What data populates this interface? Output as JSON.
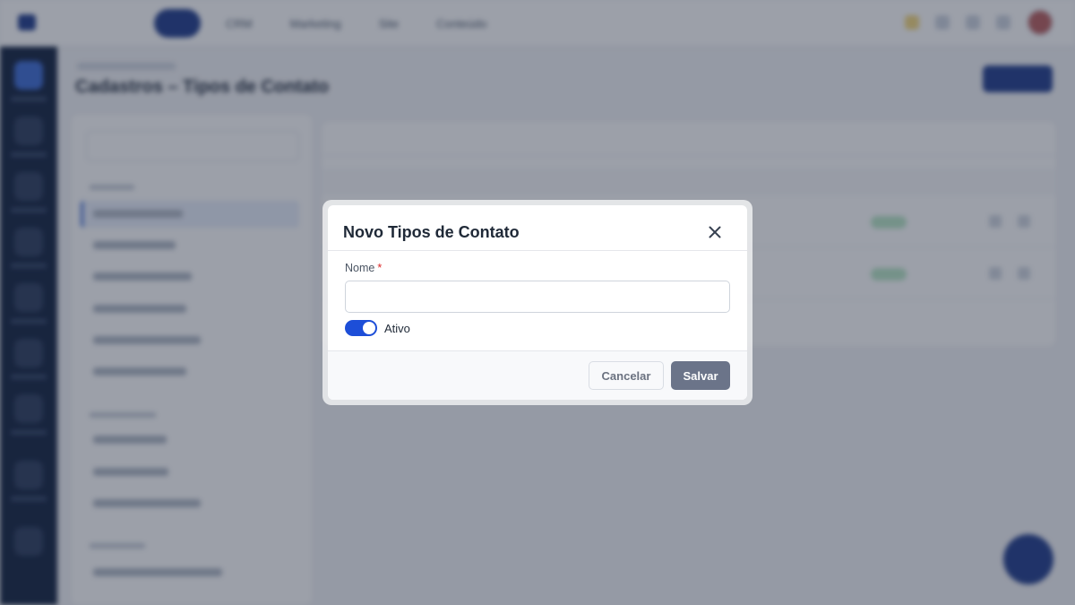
{
  "app": {
    "page_title": "Cadastros – Tipos de Contato",
    "top_nav": [
      "CRM",
      "Marketing",
      "Site",
      "Conteúdo"
    ]
  },
  "modal": {
    "title": "Novo Tipos de Contato",
    "name_field": {
      "label": "Nome",
      "required_mark": "*",
      "value": "",
      "placeholder": ""
    },
    "active_toggle": {
      "label": "Ativo",
      "checked": true
    },
    "buttons": {
      "cancel": "Cancelar",
      "save": "Salvar"
    }
  },
  "colors": {
    "accent": "#1d4ed8",
    "save_button": "#6b7489",
    "sidebar": "#0f1f3d",
    "required": "#dc2626"
  },
  "icons": {
    "close": "close-icon"
  }
}
